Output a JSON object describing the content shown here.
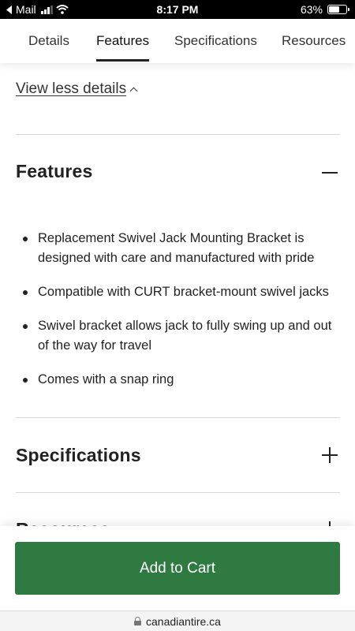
{
  "status_bar": {
    "back_app": "Mail",
    "time": "8:17 PM",
    "battery": "63%",
    "battery_level": 0.63
  },
  "tabs": [
    {
      "label": "Details",
      "active": false
    },
    {
      "label": "Features",
      "active": true
    },
    {
      "label": "Specifications",
      "active": false
    },
    {
      "label": "Resources",
      "active": false
    }
  ],
  "content": {
    "view_less_label": "View less details",
    "features": {
      "title": "Features",
      "items": [
        "Replacement Swivel Jack Mounting Bracket is designed with care and manufactured with pride",
        "Compatible with CURT bracket-mount swivel jacks",
        "Swivel bracket allows jack to fully swing up and out of the way for travel",
        "Comes with a snap ring"
      ]
    },
    "specifications": {
      "title": "Specifications"
    },
    "resources": {
      "title": "Resources"
    }
  },
  "cart": {
    "add_to_cart_label": "Add to Cart",
    "button_color": "#2f7a40"
  },
  "browser": {
    "url": "canadiantire.ca"
  }
}
